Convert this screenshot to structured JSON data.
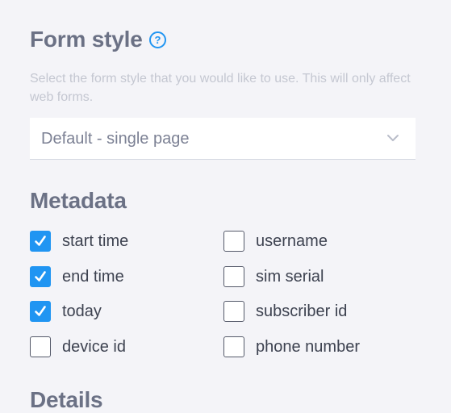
{
  "form_style": {
    "title": "Form style",
    "help_icon": "question-circle-icon",
    "description": "Select the form style that you would like to use. This will only affect web forms.",
    "selected_value": "Default - single page",
    "dropdown_icon": "chevron-down-icon"
  },
  "metadata": {
    "title": "Metadata",
    "left_column": [
      {
        "label": "start time",
        "checked": true
      },
      {
        "label": "end time",
        "checked": true
      },
      {
        "label": "today",
        "checked": true
      },
      {
        "label": "device id",
        "checked": false
      }
    ],
    "right_column": [
      {
        "label": "username",
        "checked": false
      },
      {
        "label": "sim serial",
        "checked": false
      },
      {
        "label": "subscriber id",
        "checked": false
      },
      {
        "label": "phone number",
        "checked": false
      }
    ]
  },
  "details": {
    "title": "Details"
  },
  "colors": {
    "accent": "#2095f2",
    "heading": "#6b7185",
    "background": "#f4f4f8"
  }
}
